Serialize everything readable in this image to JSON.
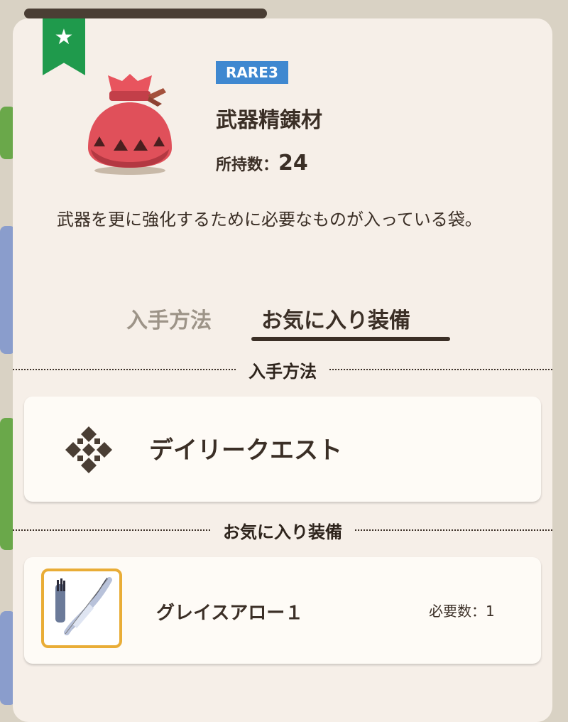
{
  "colors": {
    "accent_green": "#1f9a4c",
    "rarity_blue": "#3f88d0",
    "frame_gold": "#e9ad37",
    "panel_bg": "#f6efe8"
  },
  "favorite": {
    "icon": "star-icon",
    "glyph": "★"
  },
  "item": {
    "icon": "pouch-icon",
    "rarity": "RARE3",
    "name": "武器精錬材",
    "owned_label": "所持数：",
    "owned_count": "24",
    "description": "武器を更に強化するために必要なものが入っている袋。"
  },
  "tabs": [
    {
      "label": "入手方法",
      "active": false
    },
    {
      "label": "お気に入り装備",
      "active": true
    }
  ],
  "sections": {
    "obtain": {
      "title": "入手方法",
      "items": [
        {
          "icon": "daily-quest-icon",
          "label": "デイリークエスト"
        }
      ]
    },
    "favorites": {
      "title": "お気に入り装備",
      "items": [
        {
          "icon": "bow-icon",
          "name": "グレイスアロー１",
          "required": "必要数：1"
        }
      ]
    }
  }
}
